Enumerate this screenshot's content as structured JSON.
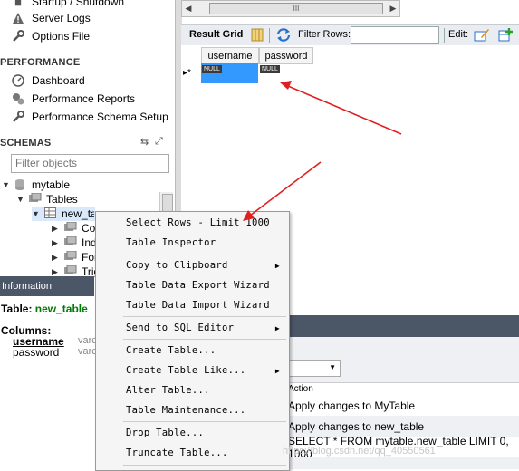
{
  "navigator": {
    "management_items": [
      {
        "label": "Startup / Shutdown",
        "icon": "startup-icon"
      },
      {
        "label": "Server Logs",
        "icon": "warning-icon"
      },
      {
        "label": "Options File",
        "icon": "wrench-icon"
      }
    ],
    "performance_title": "PERFORMANCE",
    "performance_items": [
      {
        "label": "Dashboard",
        "icon": "dashboard-icon"
      },
      {
        "label": "Performance Reports",
        "icon": "reports-icon"
      },
      {
        "label": "Performance Schema Setup",
        "icon": "wrench-icon"
      }
    ],
    "schemas_title": "SCHEMAS",
    "filter_placeholder": "Filter objects",
    "tree": {
      "schema": "mytable",
      "tables_folder": "Tables",
      "table": "new_table",
      "children": [
        "Columns",
        "Indexes",
        "Foreign Keys",
        "Triggers"
      ]
    }
  },
  "toolbar": {
    "result_grid_label": "Result Grid",
    "filter_rows_label": "Filter Rows:",
    "edit_label": "Edit:"
  },
  "grid": {
    "columns": [
      "username",
      "password"
    ],
    "row_marker": "▸*",
    "null_value": "NULL"
  },
  "info_panel": {
    "header": "Information",
    "table_label": "Table:",
    "table_name": "new_table",
    "columns_label": "Columns:",
    "columns": [
      {
        "name": "username",
        "type": "varchar"
      },
      {
        "name": "password",
        "type": "varchar"
      }
    ]
  },
  "output": {
    "column_header": "Action",
    "rows": [
      "Apply changes to MyTable",
      "Apply changes to new_table",
      "SELECT * FROM mytable.new_table LIMIT 0, 1000"
    ]
  },
  "context_menu": {
    "items": [
      "Select Rows - Limit 1000",
      "Table Inspector",
      "Copy to Clipboard",
      "Table Data Export Wizard",
      "Table Data Import Wizard",
      "Send to SQL Editor",
      "Create Table...",
      "Create Table Like...",
      "Alter Table...",
      "Table Maintenance...",
      "Drop Table...",
      "Truncate Table..."
    ]
  },
  "watermark": "https://blog.csdn.net/qq_40550561",
  "colors": {
    "panel_header": "#4b5666",
    "selection": "#3399ff",
    "table_name_green": "#007a00",
    "annotation_arrow": "#e02020"
  }
}
